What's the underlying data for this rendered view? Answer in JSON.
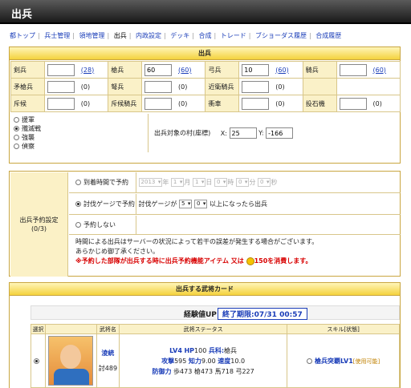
{
  "title": "出兵",
  "nav": [
    "都トップ",
    "兵士管理",
    "領地管理",
    "出兵",
    "内政設定",
    "デッキ",
    "合成",
    "トレード",
    "ブショーダス履歴",
    "合成履歴"
  ],
  "nav_current": "出兵",
  "sortie": {
    "header": "出兵",
    "rows": [
      [
        {
          "label": "剣兵",
          "value": "",
          "link": "(28)"
        },
        {
          "label": "槍兵",
          "value": "60",
          "link": "(60)"
        },
        {
          "label": "弓兵",
          "value": "10",
          "link": "(60)"
        },
        {
          "label": "騎兵",
          "value": "",
          "link": "(60)"
        }
      ],
      [
        {
          "label": "矛槍兵",
          "value": "",
          "count": "(0)"
        },
        {
          "label": "弩兵",
          "value": "",
          "count": "(0)"
        },
        {
          "label": "近衛騎兵",
          "value": "",
          "count": "(0)"
        },
        {
          "label": "",
          "value": "",
          "count": ""
        }
      ],
      [
        {
          "label": "斥候",
          "value": "",
          "count": "(0)"
        },
        {
          "label": "斥候騎兵",
          "value": "",
          "count": "(0)"
        },
        {
          "label": "衝車",
          "value": "",
          "count": "(0)"
        },
        {
          "label": "投石機",
          "value": "",
          "count": "(0)"
        }
      ]
    ],
    "modes": [
      "援軍",
      "殲滅戦",
      "強襲",
      "偵察"
    ],
    "mode_selected": 1,
    "target_label": "出兵対象の村(座標)",
    "x_label": "X:",
    "x_value": "25",
    "y_label": "Y:",
    "y_value": "-166"
  },
  "plan": {
    "side_label": "出兵予約設定",
    "side_count": "(0/3)",
    "opt1": "到着時間で予約",
    "year": "2013",
    "year_unit": "年",
    "month": "1",
    "month_unit": "月",
    "day": "1",
    "day_unit": "日",
    "hour": "0",
    "hour_unit": "時",
    "minute": "0",
    "minute_unit": "分",
    "second": "0",
    "second_unit": "秒",
    "opt2": "討伐ゲージで予約",
    "gauge_label": "討伐ゲージが",
    "gauge_a": "5",
    "gauge_b": "0",
    "gauge_suffix": "以上になったら出兵",
    "opt3": "予約しない",
    "note1": "時間による出兵はサーバーの状況によって若干の誤差が発生する場合がございます。",
    "note2": "あらかじめ御了承ください。",
    "warning": "※予約した部隊が出兵する時に出兵予約機能アイテム 又は",
    "cp_icon": "cp-coin-icon",
    "warning_tail": "150を消費します。"
  },
  "cards": {
    "header": "出兵する武将カード",
    "exp_label": "経験値UP",
    "exp_period": "終了期限:07/31 00:57",
    "cols": [
      "選択",
      "",
      "武将名",
      "武将ステータス",
      "スキル[状態]"
    ],
    "general": {
      "name": "淩統",
      "rank": "討489",
      "level": "LV4",
      "hp_label": "HP",
      "hp": "100",
      "type_label": "兵科:",
      "type": "槍兵",
      "atk_label": "攻撃",
      "atk": "595",
      "int_label": "知力",
      "int": "9.00",
      "spd_label": "速度",
      "spd": "10.0",
      "def_label": "防御力",
      "def": "歩473 槍473 馬718 弓227",
      "skill": "槍兵突覇LV1",
      "skill_state": "[使用可能]"
    }
  }
}
